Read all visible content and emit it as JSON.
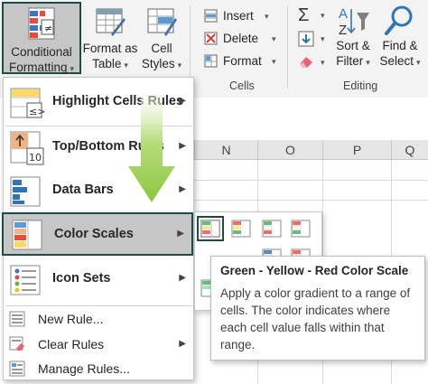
{
  "ribbon": {
    "conditional_formatting": {
      "line1": "Conditional",
      "line2": "Formatting"
    },
    "format_as_table": {
      "line1": "Format as",
      "line2": "Table"
    },
    "cell_styles": {
      "line1": "Cell",
      "line2": "Styles"
    },
    "cells_group": {
      "insert": "Insert",
      "delete": "Delete",
      "format": "Format",
      "label": "Cells"
    },
    "editing_group": {
      "sort_filter": {
        "line1": "Sort &",
        "line2": "Filter"
      },
      "find_select": {
        "line1": "Find &",
        "line2": "Select"
      },
      "label": "Editing"
    }
  },
  "columns": [
    "N",
    "O",
    "P",
    "Q"
  ],
  "menu": {
    "items": [
      {
        "label": "Highlight Cells Rules"
      },
      {
        "label": "Top/Bottom Rules"
      },
      {
        "label": "Data Bars"
      },
      {
        "label": "Color Scales"
      },
      {
        "label": "Icon Sets"
      },
      {
        "label": "New Rule..."
      },
      {
        "label": "Clear Rules"
      },
      {
        "label": "Manage Rules..."
      }
    ]
  },
  "tooltip": {
    "title": "Green - Yellow - Red Color Scale",
    "body": "Apply a color gradient to a range of cells. The color indicates where each cell value falls within that range."
  },
  "colors": {
    "accent_border": "#1e4d45",
    "selected_bg": "#c6c6c6",
    "ribbon_bg": "#f3f3f3",
    "arrow_green": "#8dc63f"
  }
}
